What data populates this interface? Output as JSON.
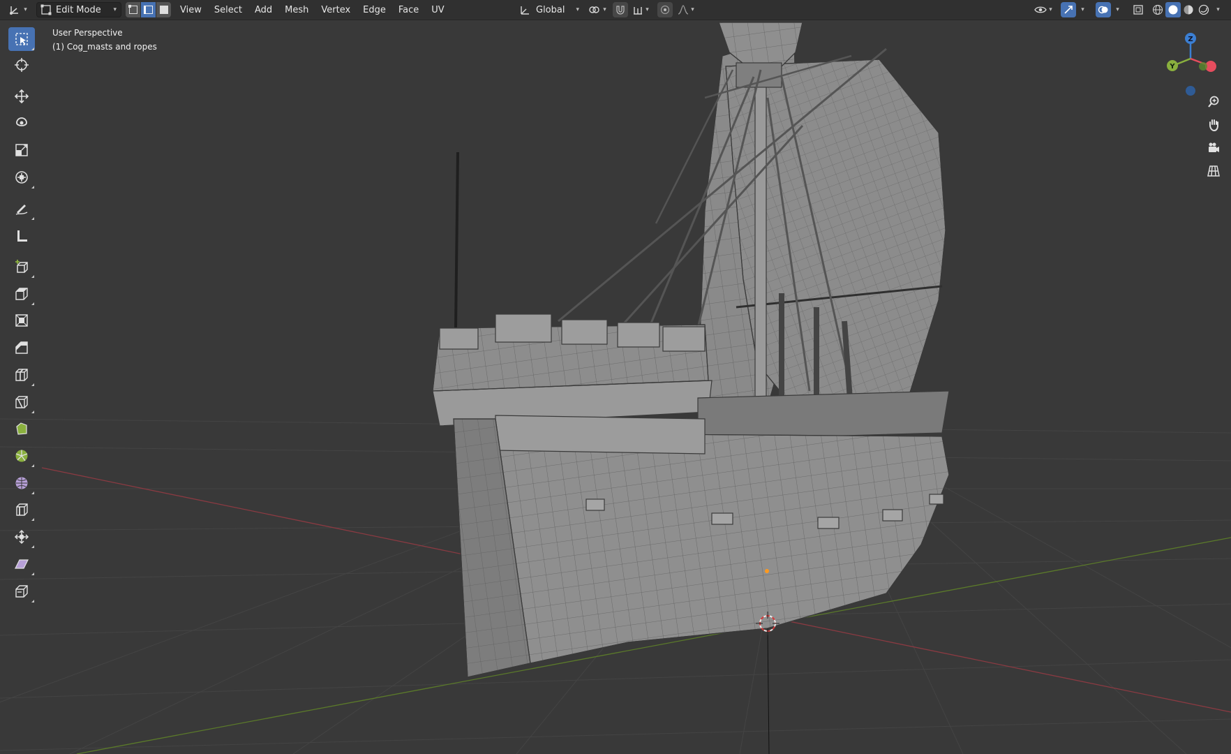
{
  "header": {
    "mode": "Edit Mode",
    "menus": [
      "View",
      "Select",
      "Add",
      "Mesh",
      "Vertex",
      "Edge",
      "Face",
      "UV"
    ],
    "transform_orientation": "Global"
  },
  "viewport": {
    "view_name": "User Perspective",
    "object_name": "(1) Cog_masts and ropes"
  },
  "gizmo": {
    "z_label": "Z",
    "y_label": "Y"
  },
  "colors": {
    "accent": "#4772b3",
    "x_axis": "#e64d5e",
    "y_axis": "#8ab03e",
    "z_axis": "#3b7fd3",
    "mesh": "#8e8e8e"
  },
  "toolbar": {
    "tools": [
      "select-box-icon",
      "cursor-icon",
      "move-icon",
      "rotate-icon",
      "scale-icon",
      "transform-icon",
      "annotate-icon",
      "measure-icon",
      "add-cube-icon",
      "extrude-icon",
      "inset-icon",
      "bevel-icon",
      "loop-cut-icon",
      "knife-icon",
      "poly-build-icon",
      "spin-icon",
      "smooth-icon",
      "edge-slide-icon",
      "shrink-fatten-icon",
      "shear-icon",
      "rip-icon"
    ],
    "active_index": 0
  },
  "navigation": [
    "zoom-icon",
    "hand-pan-icon",
    "camera-icon",
    "ortho-grid-icon"
  ]
}
